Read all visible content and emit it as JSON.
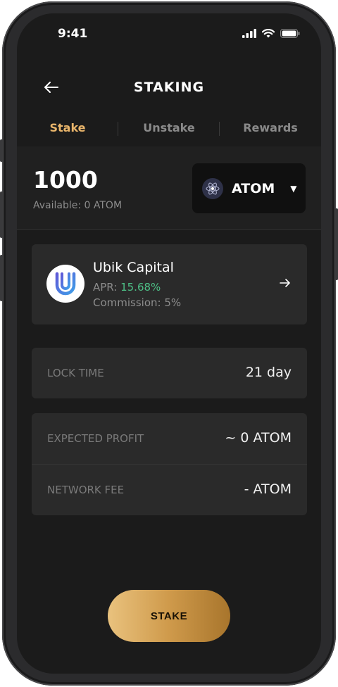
{
  "status_bar": {
    "time": "9:41"
  },
  "header": {
    "title": "STAKING"
  },
  "tabs": [
    {
      "label": "Stake",
      "active": true
    },
    {
      "label": "Unstake",
      "active": false
    },
    {
      "label": "Rewards",
      "active": false
    }
  ],
  "stake_panel": {
    "amount": "1000",
    "available": "Available: 0 ATOM",
    "token": {
      "symbol": "ATOM",
      "icon": "cosmos-atom-icon"
    }
  },
  "validator": {
    "name": "Ubik Capital",
    "apr_label": "APR: ",
    "apr_value": "15.68%",
    "commission": "Commission: 5%",
    "logo": "ubik-logo"
  },
  "lock_time": {
    "label": "LOCK TIME",
    "value": "21 day"
  },
  "details": {
    "expected_profit_label": "EXPECTED PROFIT",
    "expected_profit_value": "~ 0 ATOM",
    "network_fee_label": "NETWORK FEE",
    "network_fee_value": "- ATOM"
  },
  "stake_button": {
    "label": "STAKE"
  },
  "colors": {
    "accent_gold": "#e9b56b",
    "apr_green": "#4dbf86",
    "background": "#1b1b1b",
    "card": "#2a2a2a"
  }
}
